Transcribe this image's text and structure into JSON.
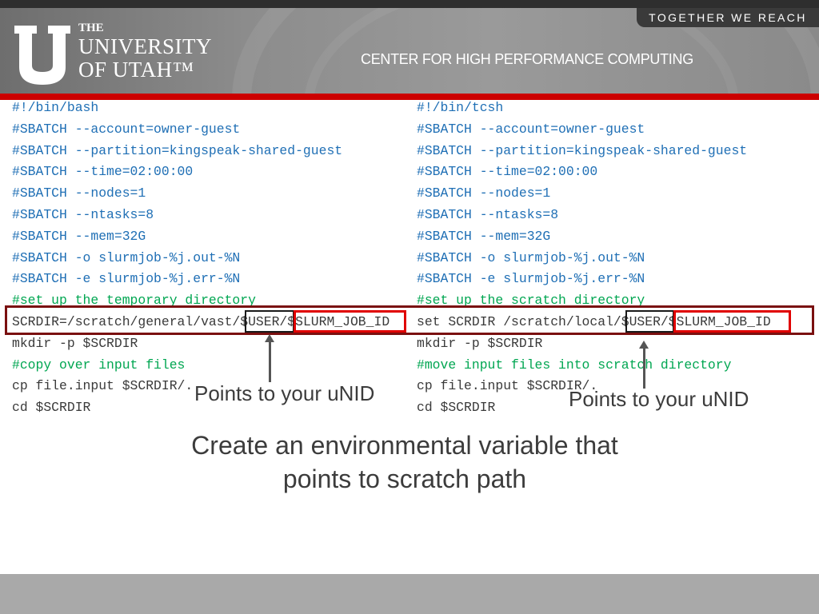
{
  "header": {
    "tagline": "TOGETHER WE REACH",
    "logo": {
      "line1": "THE",
      "line2": "UNIVERSITY",
      "line3": "OF UTAH™"
    },
    "center_name": "CENTER FOR HIGH PERFORMANCE COMPUTING"
  },
  "colors": {
    "accent_red": "#cc0000",
    "directive_blue": "#1f6fb5",
    "comment_green": "#00a651"
  },
  "left_script": {
    "lines": [
      {
        "text": "#!/bin/bash",
        "kind": "dir"
      },
      {
        "text": "#SBATCH --account=owner-guest",
        "kind": "dir"
      },
      {
        "text": "#SBATCH --partition=kingspeak-shared-guest",
        "kind": "dir"
      },
      {
        "text": "#SBATCH --time=02:00:00",
        "kind": "dir"
      },
      {
        "text": "#SBATCH --nodes=1",
        "kind": "dir"
      },
      {
        "text": "#SBATCH --ntasks=8",
        "kind": "dir"
      },
      {
        "text": "#SBATCH --mem=32G",
        "kind": "dir"
      },
      {
        "text": "#SBATCH -o slurmjob-%j.out-%N",
        "kind": "dir"
      },
      {
        "text": "#SBATCH -e slurmjob-%j.err-%N",
        "kind": "dir"
      },
      {
        "text": "#set up the temporary directory",
        "kind": "comment"
      },
      {
        "text": "SCRDIR=/scratch/general/vast/",
        "kind": "cmd"
      },
      {
        "text": "mkdir -p $SCRDIR",
        "kind": "cmd"
      },
      {
        "text": "#copy over input files",
        "kind": "comment"
      },
      {
        "text": "cp file.input $SCRDIR/.",
        "kind": "cmd"
      },
      {
        "text": "cd $SCRDIR",
        "kind": "cmd"
      }
    ],
    "user_part": "$USER/",
    "job_part": "$SLURM_JOB_ID",
    "note": "Points to your uNID"
  },
  "right_script": {
    "lines": [
      {
        "text": "#!/bin/tcsh",
        "kind": "dir"
      },
      {
        "text": "#SBATCH --account=owner-guest",
        "kind": "dir"
      },
      {
        "text": "#SBATCH --partition=kingspeak-shared-guest",
        "kind": "dir"
      },
      {
        "text": "#SBATCH --time=02:00:00",
        "kind": "dir"
      },
      {
        "text": "#SBATCH --nodes=1",
        "kind": "dir"
      },
      {
        "text": "#SBATCH --ntasks=8",
        "kind": "dir"
      },
      {
        "text": "#SBATCH --mem=32G",
        "kind": "dir"
      },
      {
        "text": "#SBATCH -o slurmjob-%j.out-%N",
        "kind": "dir"
      },
      {
        "text": "#SBATCH -e slurmjob-%j.err-%N",
        "kind": "dir"
      },
      {
        "text": "#set up the scratch directory",
        "kind": "comment"
      },
      {
        "text": "set SCRDIR /scratch/local/",
        "kind": "cmd"
      },
      {
        "text": "mkdir -p $SCRDIR",
        "kind": "cmd"
      },
      {
        "text": "#move input files into scratch directory",
        "kind": "comment"
      },
      {
        "text": "cp file.input $SCRDIR/.",
        "kind": "cmd"
      },
      {
        "text": "cd $SCRDIR",
        "kind": "cmd"
      }
    ],
    "user_part": "$USER/",
    "job_part": "$SLURM_JOB_ID",
    "note": "Points to your uNID"
  },
  "caption": {
    "line1": "Create an environmental variable that",
    "line2": "points to scratch path"
  }
}
